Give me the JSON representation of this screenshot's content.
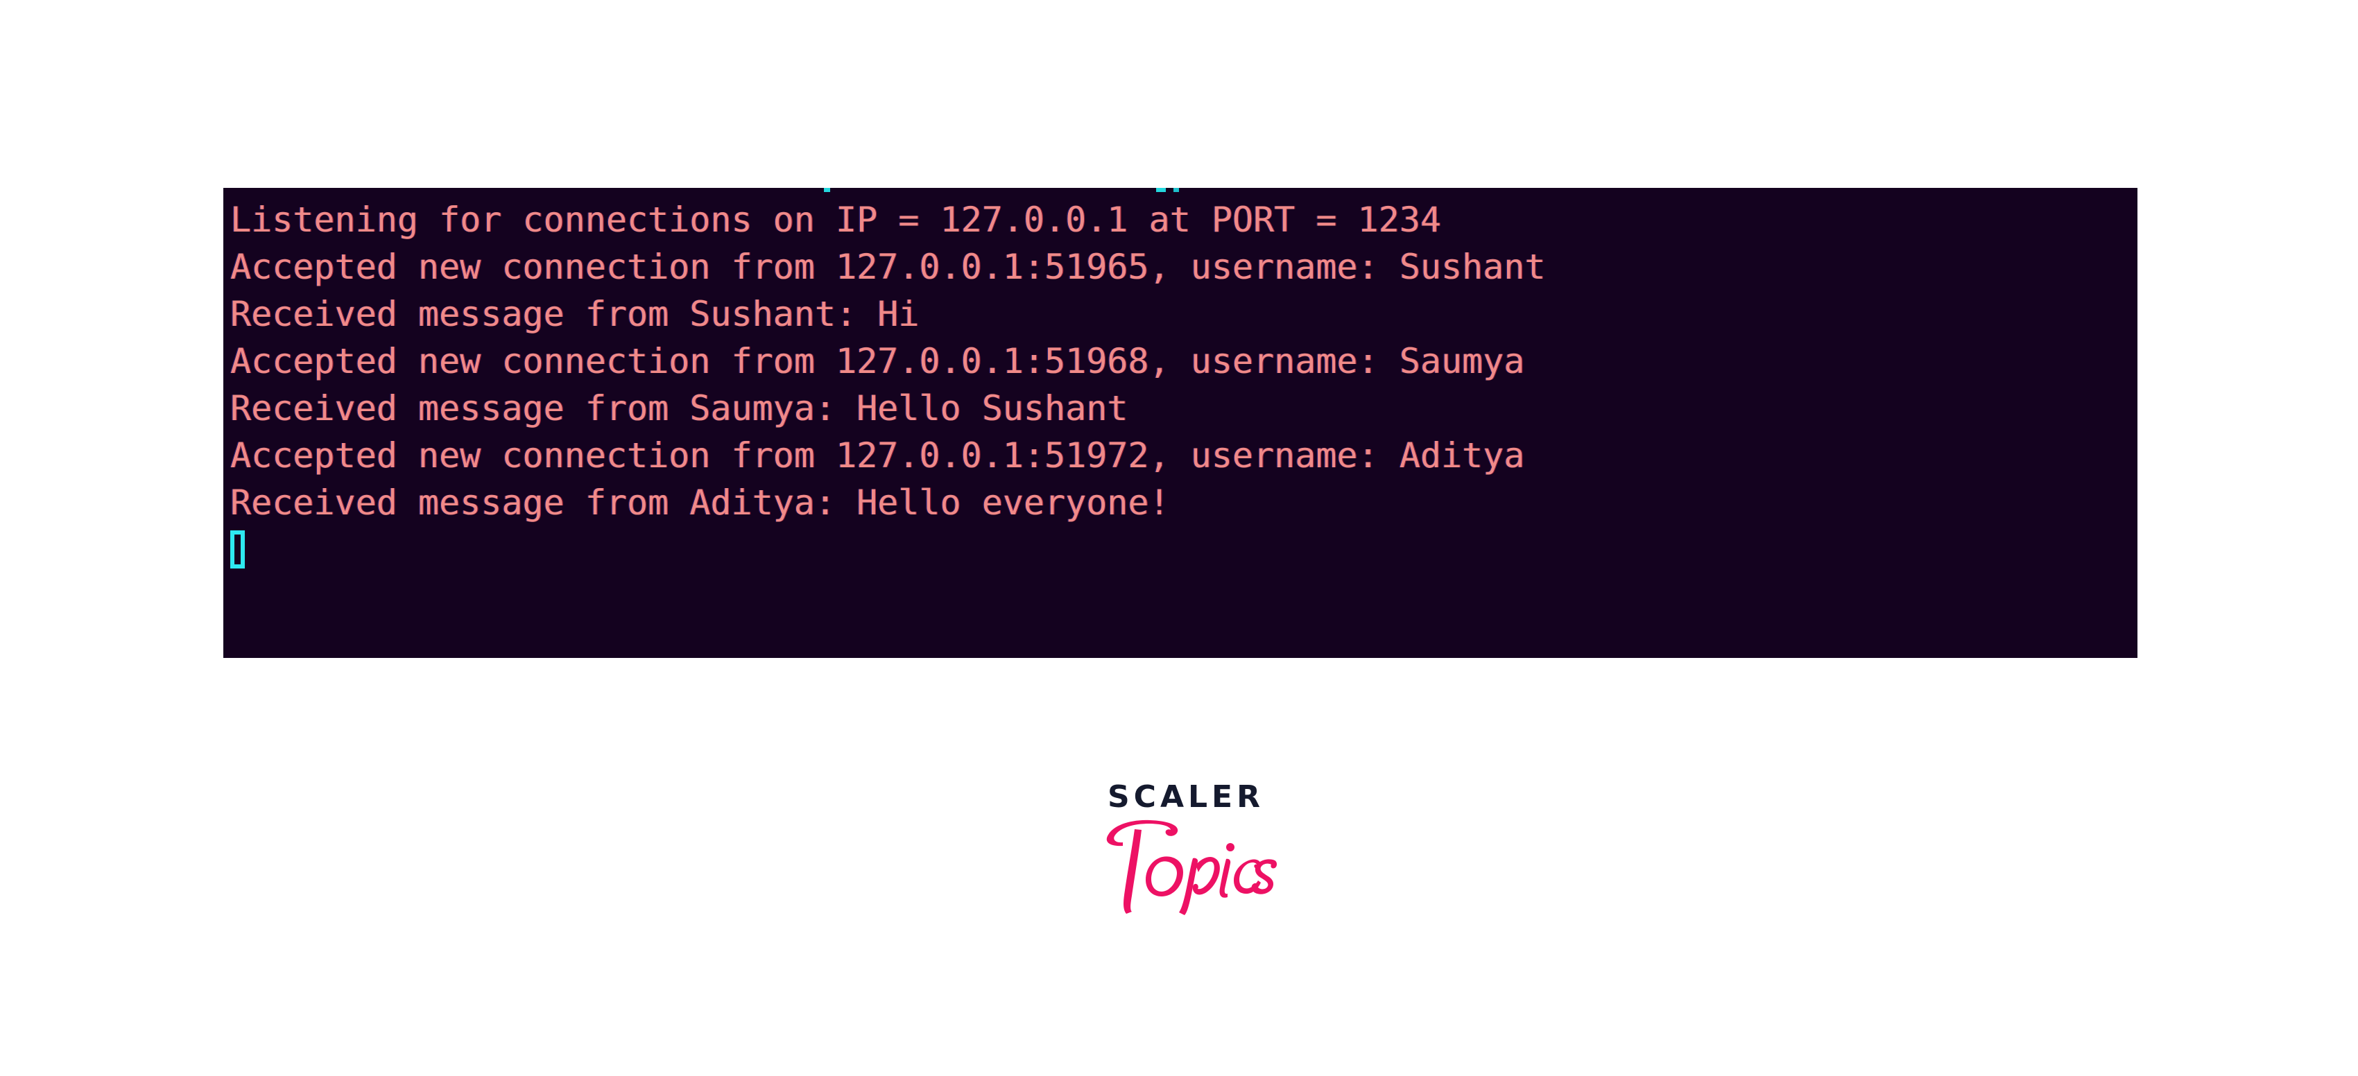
{
  "terminal": {
    "background_color": "#14021f",
    "text_color": "#f08a88",
    "cursor_color": "#2ee9f0",
    "lines": [
      "Listening for connections on IP = 127.0.0.1 at PORT = 1234",
      "Accepted new connection from 127.0.0.1:51965, username: Sushant",
      "Received message from Sushant: Hi",
      "Accepted new connection from 127.0.0.1:51968, username: Saumya",
      "Received message from Saumya: Hello Sushant",
      "Accepted new connection from 127.0.0.1:51972, username: Aditya",
      "Received message from Aditya: Hello everyone!"
    ],
    "cursor": {
      "name": "block-cursor",
      "style": "hollow-block"
    }
  },
  "logo": {
    "wordmark": "SCALER",
    "script": "Topics",
    "wordmark_color": "#151a2e",
    "script_color": "#ed1164"
  }
}
